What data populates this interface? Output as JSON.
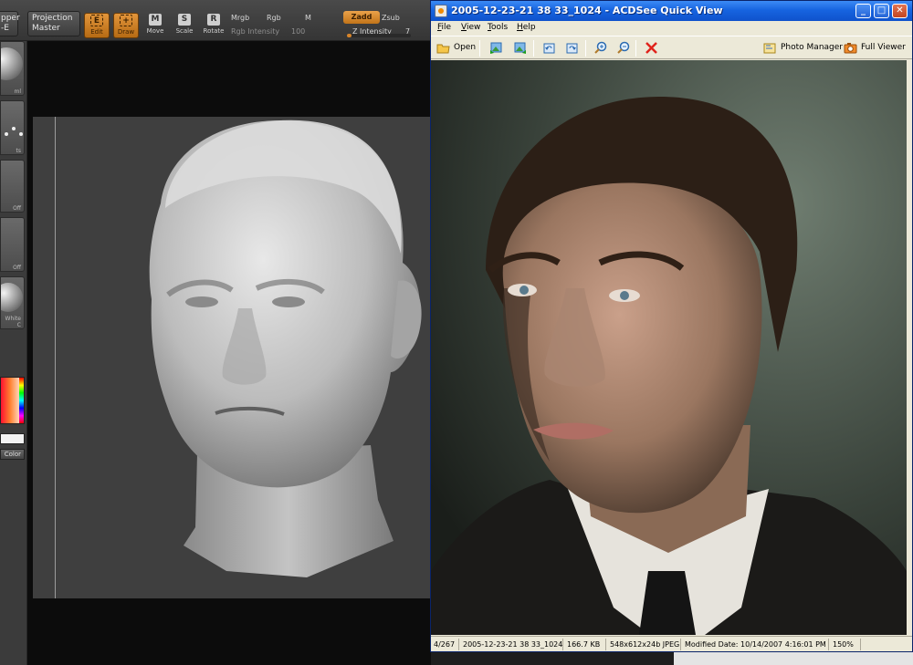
{
  "zbrush": {
    "big_buttons": [
      {
        "line1": "pper",
        "line2": "-E"
      },
      {
        "line1": "Projection",
        "line2": "Master"
      }
    ],
    "tools": [
      {
        "key": "E",
        "label": "Edit",
        "active": true
      },
      {
        "key": "+",
        "label": "Draw",
        "active": true
      },
      {
        "key": "M",
        "label": "Move",
        "active": false
      },
      {
        "key": "S",
        "label": "Scale",
        "active": false
      },
      {
        "key": "R",
        "label": "Rotate",
        "active": false
      }
    ],
    "mrgb": "Mrgb",
    "rgb": "Rgb",
    "m": "M",
    "rgb_intensity_label": "Rgb Intensity",
    "rgb_intensity_value": "100",
    "zadd": "Zadd",
    "zsub": "Zsub",
    "z_intensity_label": "Z Intensity",
    "z_intensity_value": "7",
    "z_intensity_fraction": 0.07,
    "side_labels": [
      "ml",
      "ts",
      "Off",
      "Off",
      "White C"
    ],
    "color_button": "Color"
  },
  "acdsee": {
    "title": "2005-12-23-21 38 33_1024 - ACDSee Quick View",
    "win_buttons": {
      "minimize": "_",
      "maximize": "□",
      "close": "✕"
    },
    "menu": [
      "File",
      "View",
      "Tools",
      "Help"
    ],
    "toolbar": {
      "open_label": "Open",
      "photo_manager_label": "Photo Manager",
      "full_viewer_label": "Full Viewer"
    },
    "status": {
      "index": "4/267",
      "filename": "2005-12-23-21 38 33_1024",
      "size": "166.7 KB",
      "dimensions": "548x612x24b JPEG",
      "modified": "Modified Date: 10/14/2007 4:16:01 PM",
      "zoom": "150%"
    }
  }
}
